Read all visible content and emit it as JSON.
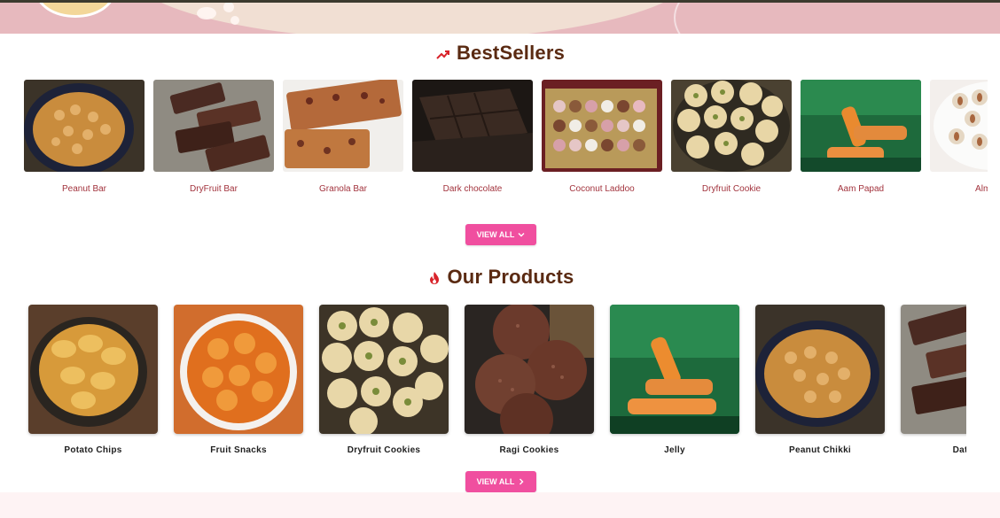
{
  "bestsellers": {
    "title": "BestSellers",
    "icon": "trending-up-icon",
    "view_all_label": "VIEW ALL",
    "items": [
      {
        "name": "Peanut Bar"
      },
      {
        "name": "DryFruit Bar"
      },
      {
        "name": "Granola Bar"
      },
      {
        "name": "Dark chocolate"
      },
      {
        "name": "Coconut Laddoo"
      },
      {
        "name": "Dryfruit Cookie"
      },
      {
        "name": "Aam Papad"
      },
      {
        "name": "Almond"
      }
    ]
  },
  "products": {
    "title": "Our Products",
    "icon": "fire-icon",
    "view_all_label": "VIEW ALL",
    "items": [
      {
        "name": "Potato Chips"
      },
      {
        "name": "Fruit Snacks"
      },
      {
        "name": "Dryfruit Cookies"
      },
      {
        "name": "Ragi Cookies"
      },
      {
        "name": "Jelly"
      },
      {
        "name": "Peanut Chikki"
      },
      {
        "name": "Dates"
      }
    ]
  },
  "colors": {
    "accent": "#f04f9f",
    "title": "#5a2a12",
    "bestseller_label": "#a2333d"
  }
}
